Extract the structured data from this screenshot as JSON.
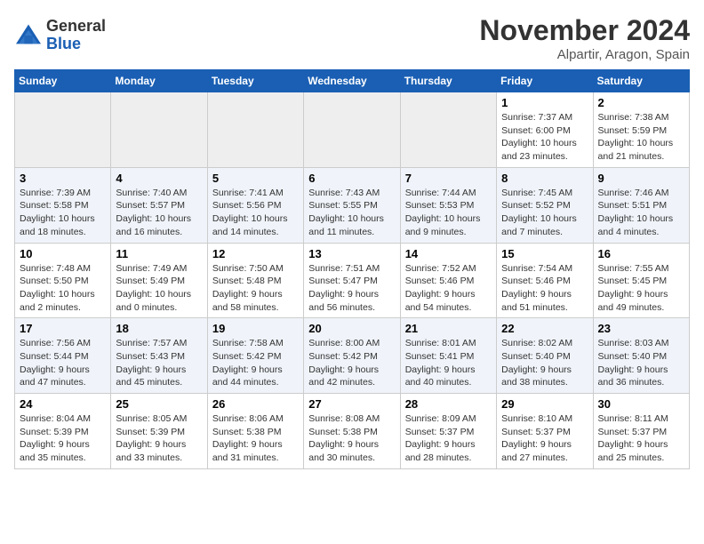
{
  "logo": {
    "name1": "General",
    "name2": "Blue"
  },
  "title": "November 2024",
  "location": "Alpartir, Aragon, Spain",
  "weekdays": [
    "Sunday",
    "Monday",
    "Tuesday",
    "Wednesday",
    "Thursday",
    "Friday",
    "Saturday"
  ],
  "weeks": [
    {
      "shaded": false,
      "days": [
        {
          "num": "",
          "info": "",
          "empty": true
        },
        {
          "num": "",
          "info": "",
          "empty": true
        },
        {
          "num": "",
          "info": "",
          "empty": true
        },
        {
          "num": "",
          "info": "",
          "empty": true
        },
        {
          "num": "",
          "info": "",
          "empty": true
        },
        {
          "num": "1",
          "info": "Sunrise: 7:37 AM\nSunset: 6:00 PM\nDaylight: 10 hours\nand 23 minutes.",
          "empty": false
        },
        {
          "num": "2",
          "info": "Sunrise: 7:38 AM\nSunset: 5:59 PM\nDaylight: 10 hours\nand 21 minutes.",
          "empty": false
        }
      ]
    },
    {
      "shaded": true,
      "days": [
        {
          "num": "3",
          "info": "Sunrise: 7:39 AM\nSunset: 5:58 PM\nDaylight: 10 hours\nand 18 minutes.",
          "empty": false
        },
        {
          "num": "4",
          "info": "Sunrise: 7:40 AM\nSunset: 5:57 PM\nDaylight: 10 hours\nand 16 minutes.",
          "empty": false
        },
        {
          "num": "5",
          "info": "Sunrise: 7:41 AM\nSunset: 5:56 PM\nDaylight: 10 hours\nand 14 minutes.",
          "empty": false
        },
        {
          "num": "6",
          "info": "Sunrise: 7:43 AM\nSunset: 5:55 PM\nDaylight: 10 hours\nand 11 minutes.",
          "empty": false
        },
        {
          "num": "7",
          "info": "Sunrise: 7:44 AM\nSunset: 5:53 PM\nDaylight: 10 hours\nand 9 minutes.",
          "empty": false
        },
        {
          "num": "8",
          "info": "Sunrise: 7:45 AM\nSunset: 5:52 PM\nDaylight: 10 hours\nand 7 minutes.",
          "empty": false
        },
        {
          "num": "9",
          "info": "Sunrise: 7:46 AM\nSunset: 5:51 PM\nDaylight: 10 hours\nand 4 minutes.",
          "empty": false
        }
      ]
    },
    {
      "shaded": false,
      "days": [
        {
          "num": "10",
          "info": "Sunrise: 7:48 AM\nSunset: 5:50 PM\nDaylight: 10 hours\nand 2 minutes.",
          "empty": false
        },
        {
          "num": "11",
          "info": "Sunrise: 7:49 AM\nSunset: 5:49 PM\nDaylight: 10 hours\nand 0 minutes.",
          "empty": false
        },
        {
          "num": "12",
          "info": "Sunrise: 7:50 AM\nSunset: 5:48 PM\nDaylight: 9 hours\nand 58 minutes.",
          "empty": false
        },
        {
          "num": "13",
          "info": "Sunrise: 7:51 AM\nSunset: 5:47 PM\nDaylight: 9 hours\nand 56 minutes.",
          "empty": false
        },
        {
          "num": "14",
          "info": "Sunrise: 7:52 AM\nSunset: 5:46 PM\nDaylight: 9 hours\nand 54 minutes.",
          "empty": false
        },
        {
          "num": "15",
          "info": "Sunrise: 7:54 AM\nSunset: 5:46 PM\nDaylight: 9 hours\nand 51 minutes.",
          "empty": false
        },
        {
          "num": "16",
          "info": "Sunrise: 7:55 AM\nSunset: 5:45 PM\nDaylight: 9 hours\nand 49 minutes.",
          "empty": false
        }
      ]
    },
    {
      "shaded": true,
      "days": [
        {
          "num": "17",
          "info": "Sunrise: 7:56 AM\nSunset: 5:44 PM\nDaylight: 9 hours\nand 47 minutes.",
          "empty": false
        },
        {
          "num": "18",
          "info": "Sunrise: 7:57 AM\nSunset: 5:43 PM\nDaylight: 9 hours\nand 45 minutes.",
          "empty": false
        },
        {
          "num": "19",
          "info": "Sunrise: 7:58 AM\nSunset: 5:42 PM\nDaylight: 9 hours\nand 44 minutes.",
          "empty": false
        },
        {
          "num": "20",
          "info": "Sunrise: 8:00 AM\nSunset: 5:42 PM\nDaylight: 9 hours\nand 42 minutes.",
          "empty": false
        },
        {
          "num": "21",
          "info": "Sunrise: 8:01 AM\nSunset: 5:41 PM\nDaylight: 9 hours\nand 40 minutes.",
          "empty": false
        },
        {
          "num": "22",
          "info": "Sunrise: 8:02 AM\nSunset: 5:40 PM\nDaylight: 9 hours\nand 38 minutes.",
          "empty": false
        },
        {
          "num": "23",
          "info": "Sunrise: 8:03 AM\nSunset: 5:40 PM\nDaylight: 9 hours\nand 36 minutes.",
          "empty": false
        }
      ]
    },
    {
      "shaded": false,
      "days": [
        {
          "num": "24",
          "info": "Sunrise: 8:04 AM\nSunset: 5:39 PM\nDaylight: 9 hours\nand 35 minutes.",
          "empty": false
        },
        {
          "num": "25",
          "info": "Sunrise: 8:05 AM\nSunset: 5:39 PM\nDaylight: 9 hours\nand 33 minutes.",
          "empty": false
        },
        {
          "num": "26",
          "info": "Sunrise: 8:06 AM\nSunset: 5:38 PM\nDaylight: 9 hours\nand 31 minutes.",
          "empty": false
        },
        {
          "num": "27",
          "info": "Sunrise: 8:08 AM\nSunset: 5:38 PM\nDaylight: 9 hours\nand 30 minutes.",
          "empty": false
        },
        {
          "num": "28",
          "info": "Sunrise: 8:09 AM\nSunset: 5:37 PM\nDaylight: 9 hours\nand 28 minutes.",
          "empty": false
        },
        {
          "num": "29",
          "info": "Sunrise: 8:10 AM\nSunset: 5:37 PM\nDaylight: 9 hours\nand 27 minutes.",
          "empty": false
        },
        {
          "num": "30",
          "info": "Sunrise: 8:11 AM\nSunset: 5:37 PM\nDaylight: 9 hours\nand 25 minutes.",
          "empty": false
        }
      ]
    }
  ]
}
